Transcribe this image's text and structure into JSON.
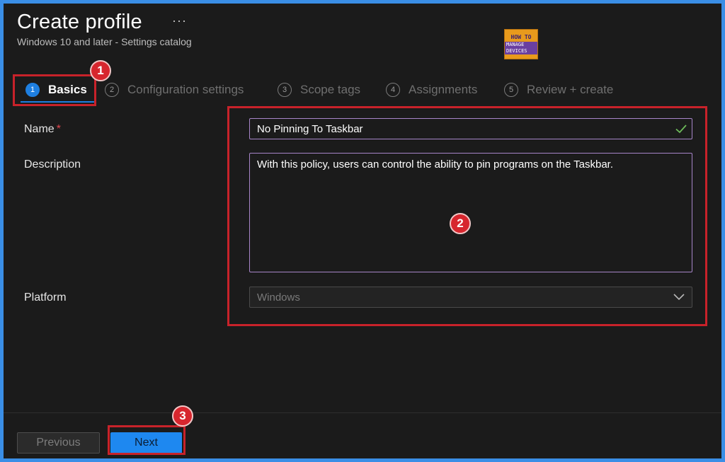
{
  "header": {
    "title": "Create profile",
    "more_label": "···",
    "subtitle": "Windows 10 and later - Settings catalog"
  },
  "logo": {
    "line1": "HOW TO",
    "line2": "MANAGE DEVICES"
  },
  "wizard": {
    "steps": [
      {
        "num": "1",
        "label": "Basics",
        "active": true
      },
      {
        "num": "2",
        "label": "Configuration settings",
        "active": false
      },
      {
        "num": "3",
        "label": "Scope tags",
        "active": false
      },
      {
        "num": "4",
        "label": "Assignments",
        "active": false
      },
      {
        "num": "5",
        "label": "Review + create",
        "active": false
      }
    ]
  },
  "form": {
    "name_label": "Name",
    "required_marker": "*",
    "name_value": "No Pinning To Taskbar",
    "description_label": "Description",
    "description_value": "With this policy, users can control the ability to pin programs on the Taskbar.",
    "platform_label": "Platform",
    "platform_value": "Windows"
  },
  "footer": {
    "previous_label": "Previous",
    "next_label": "Next"
  },
  "annotations": {
    "badge_1": "1",
    "badge_2": "2",
    "badge_3": "3"
  },
  "colors": {
    "accent": "#1e88f0",
    "annotation_red": "#c8222a",
    "input_border": "#a785c9",
    "background": "#1b1b1b"
  }
}
